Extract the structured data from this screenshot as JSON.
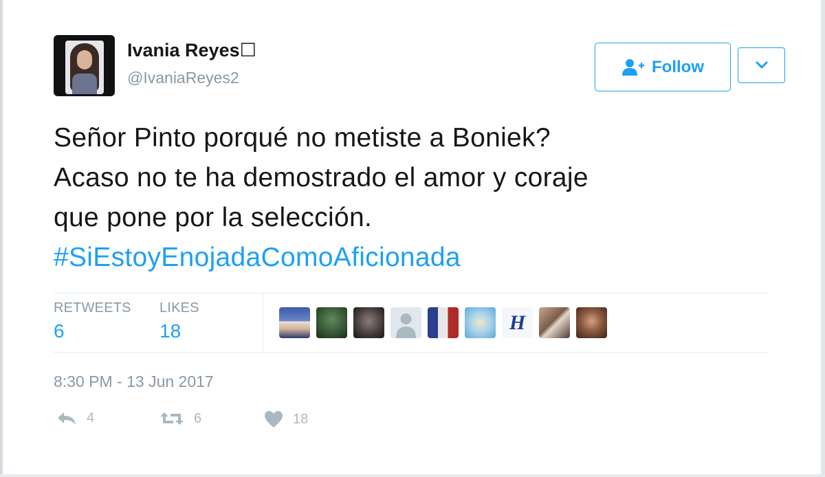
{
  "tweet": {
    "author": {
      "display_name": "Ivania Reyes☐",
      "handle": "@IvaniaReyes2"
    },
    "follow_label": "Follow",
    "text_lines": [
      "Señor Pinto porqué no metiste a Boniek?",
      "Acaso no te ha demostrado el amor y coraje",
      "que pone por la selección."
    ],
    "hashtag": "#SiEstoyEnojadaComoAficionada",
    "stats": {
      "retweets_label": "RETWEETS",
      "retweets_count": "6",
      "likes_label": "LIKES",
      "likes_count": "18"
    },
    "likers": [
      {
        "icon": "avatar-man-tv"
      },
      {
        "icon": "avatar-green-photo"
      },
      {
        "icon": "avatar-dark-photo"
      },
      {
        "icon": "avatar-default-silhouette"
      },
      {
        "icon": "avatar-flag"
      },
      {
        "icon": "avatar-blue-illustration"
      },
      {
        "icon": "avatar-letter-h",
        "letter": "H"
      },
      {
        "icon": "avatar-couple"
      },
      {
        "icon": "avatar-woman"
      }
    ],
    "timestamp": "8:30 PM - 13 Jun 2017",
    "actions": {
      "reply_count": "4",
      "retweet_count": "6",
      "like_count": "18"
    }
  },
  "colors": {
    "accent": "#1da1f2",
    "text": "#14171a",
    "muted": "#8899a6",
    "action_icon": "#aab8c2"
  }
}
